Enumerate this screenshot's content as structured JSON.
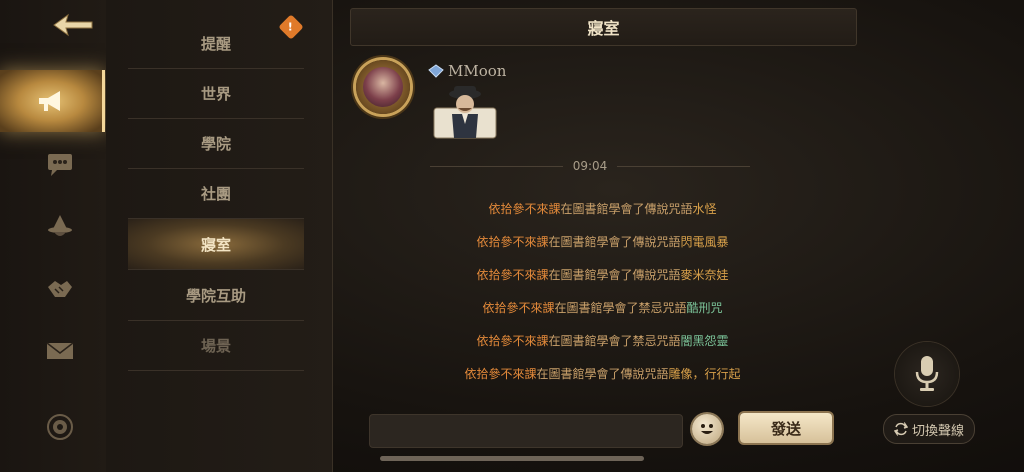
{
  "nav": {
    "back_icon": "back-arrow-icon",
    "rail": [
      {
        "icon": "megaphone-icon",
        "active": true
      },
      {
        "icon": "chat-bubble-icon",
        "active": false
      },
      {
        "icon": "wizard-hat-icon",
        "active": false
      },
      {
        "icon": "handshake-icon",
        "active": false
      },
      {
        "icon": "envelope-icon",
        "active": false
      },
      {
        "icon": "settings-gear-icon",
        "active": false
      }
    ]
  },
  "channels": {
    "items": [
      {
        "label": "提醒"
      },
      {
        "label": "世界"
      },
      {
        "label": "學院"
      },
      {
        "label": "社團"
      },
      {
        "label": "寢室"
      },
      {
        "label": "學院互助"
      },
      {
        "label": "場景"
      }
    ],
    "active_index": 4,
    "badge": "!"
  },
  "chat": {
    "title": "寢室",
    "message": {
      "username": "MMoon",
      "user_icon": "blue-gem-icon",
      "sticker": "detective-sticker"
    },
    "time": "09:04",
    "system_messages": [
      {
        "name": "依拾參不來課",
        "body": "在圖書館學會了傳說咒語",
        "spell": "水怪",
        "spell_color": "#d8a04a"
      },
      {
        "name": "依拾參不來課",
        "body": "在圖書館學會了傳說咒語",
        "spell": "閃電風暴",
        "spell_color": "#d8a04a"
      },
      {
        "name": "依拾參不來課",
        "body": "在圖書館學會了傳說咒語",
        "spell": "麥米奈娃",
        "spell_color": "#d8a04a"
      },
      {
        "name": "依拾參不來課",
        "body": "在圖書館學會了禁忌咒語",
        "spell": "酷刑咒",
        "spell_color": "#7cc59a"
      },
      {
        "name": "依拾參不來課",
        "body": "在圖書館學會了禁忌咒語",
        "spell": "闇黑怨靈",
        "spell_color": "#7cc59a"
      },
      {
        "name": "依拾參不來課",
        "body": "在圖書館學會了傳說咒語",
        "spell": "雕像，行行起",
        "spell_color": "#d8a04a"
      }
    ]
  },
  "input": {
    "placeholder": "",
    "send_label": "發送",
    "switch_label": "切換聲線"
  },
  "colors": {
    "accent_gold": "#e6c275",
    "name_orange": "#e48a3a",
    "legend_spell": "#d8a04a",
    "forbidden_spell": "#7cc59a"
  }
}
